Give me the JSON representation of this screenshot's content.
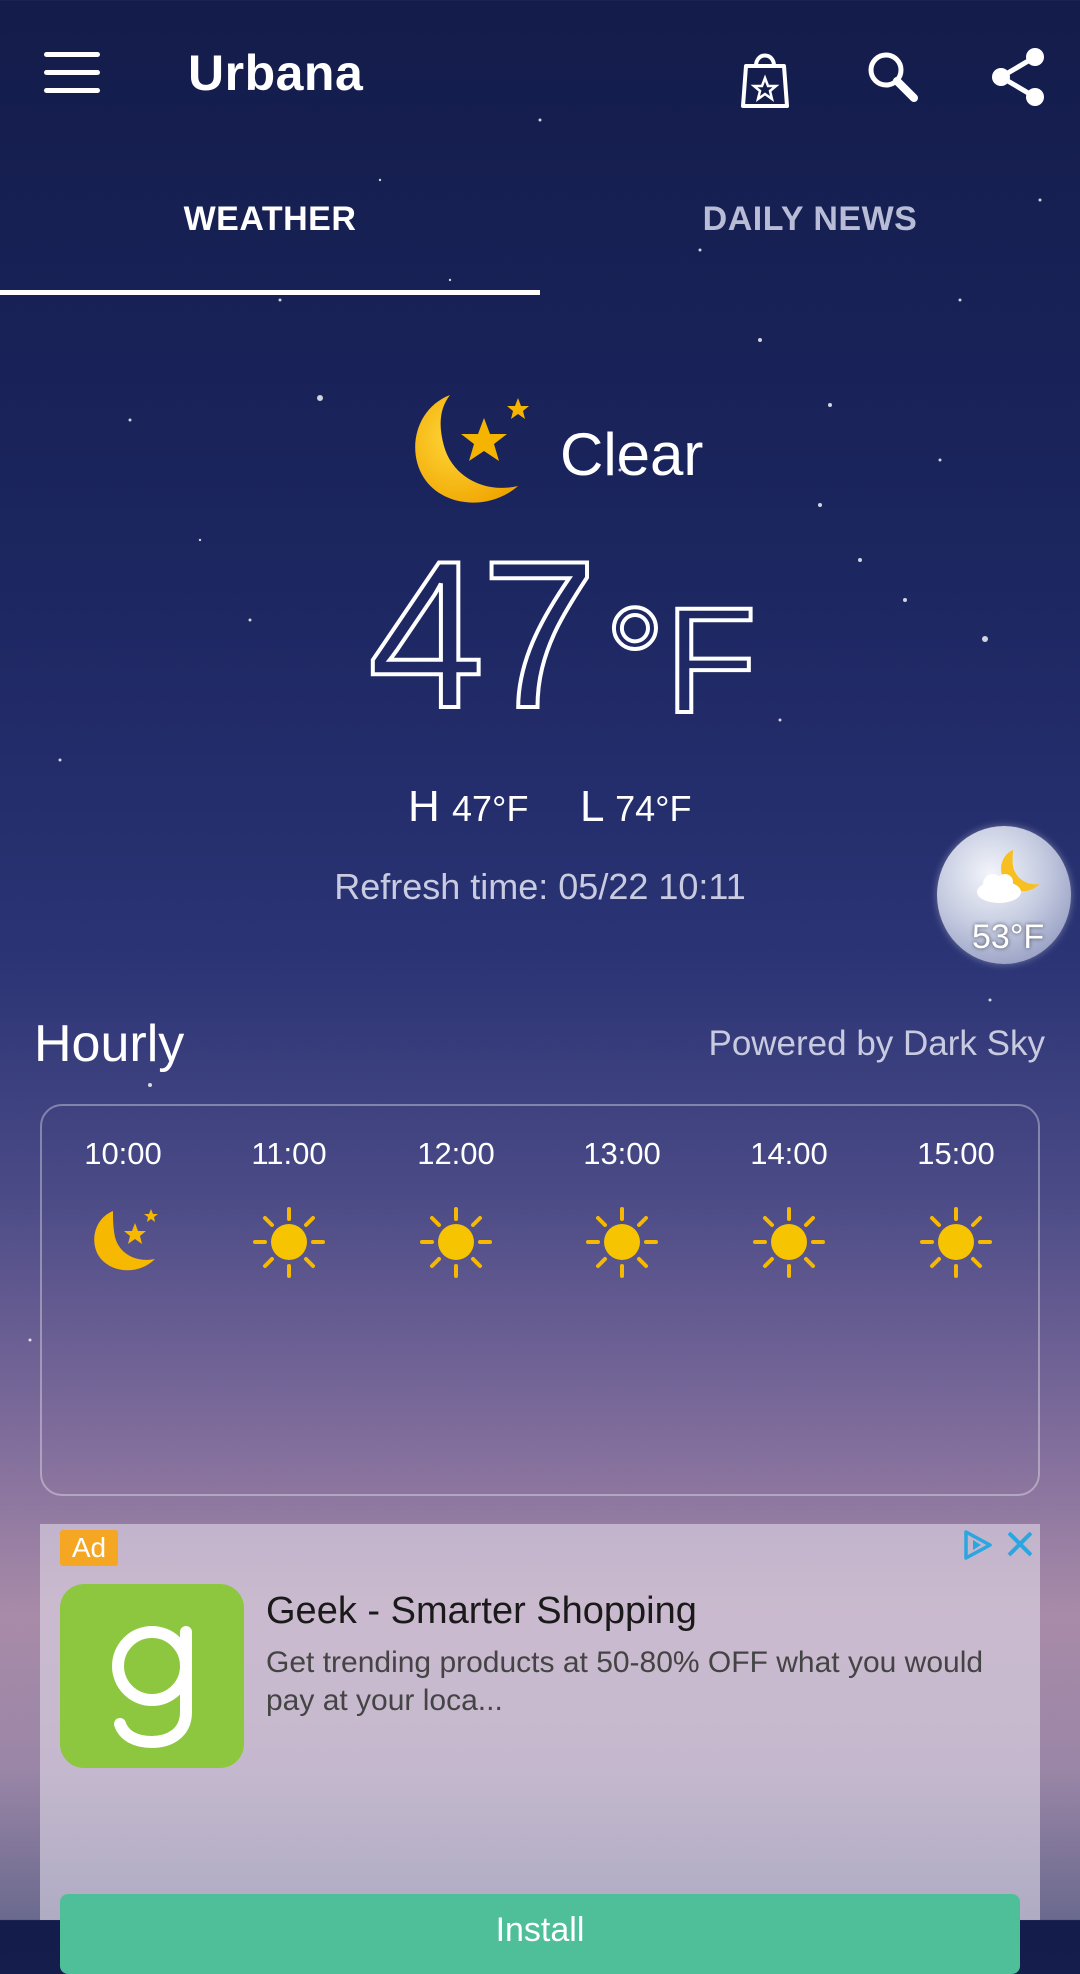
{
  "header": {
    "city": "Urbana",
    "icons": [
      "menu-icon",
      "shopping-bag-icon",
      "search-icon",
      "share-icon"
    ]
  },
  "tabs": [
    {
      "label": "WEATHER",
      "active": true
    },
    {
      "label": "DAILY NEWS",
      "active": false
    }
  ],
  "current": {
    "condition": "Clear",
    "condition_icon": "moon-stars-icon",
    "temp": "47",
    "unit": "°F",
    "high_label": "H",
    "high": "47°F",
    "low_label": "L",
    "low": "74°F",
    "refresh": "Refresh time: 05/22 10:11"
  },
  "floating_widget": {
    "temp": "53°F",
    "icon": "moon-cloud-icon"
  },
  "hourly": {
    "title": "Hourly",
    "powered_by": "Powered by Dark Sky",
    "hours": [
      {
        "time": "10:00",
        "icon": "moon-stars-icon"
      },
      {
        "time": "11:00",
        "icon": "sun-icon"
      },
      {
        "time": "12:00",
        "icon": "sun-icon"
      },
      {
        "time": "13:00",
        "icon": "sun-icon"
      },
      {
        "time": "14:00",
        "icon": "sun-icon"
      },
      {
        "time": "15:00",
        "icon": "sun-icon"
      }
    ]
  },
  "ad": {
    "badge": "Ad",
    "logo_letter": "g",
    "title": "Geek - Smarter Shopping",
    "description": "Get trending products at 50-80% OFF what you would pay at your loca...",
    "cta": "Install",
    "colors": {
      "badge": "#f5a623",
      "logo": "#8dc63f",
      "cta": "#4fbf9a"
    }
  }
}
